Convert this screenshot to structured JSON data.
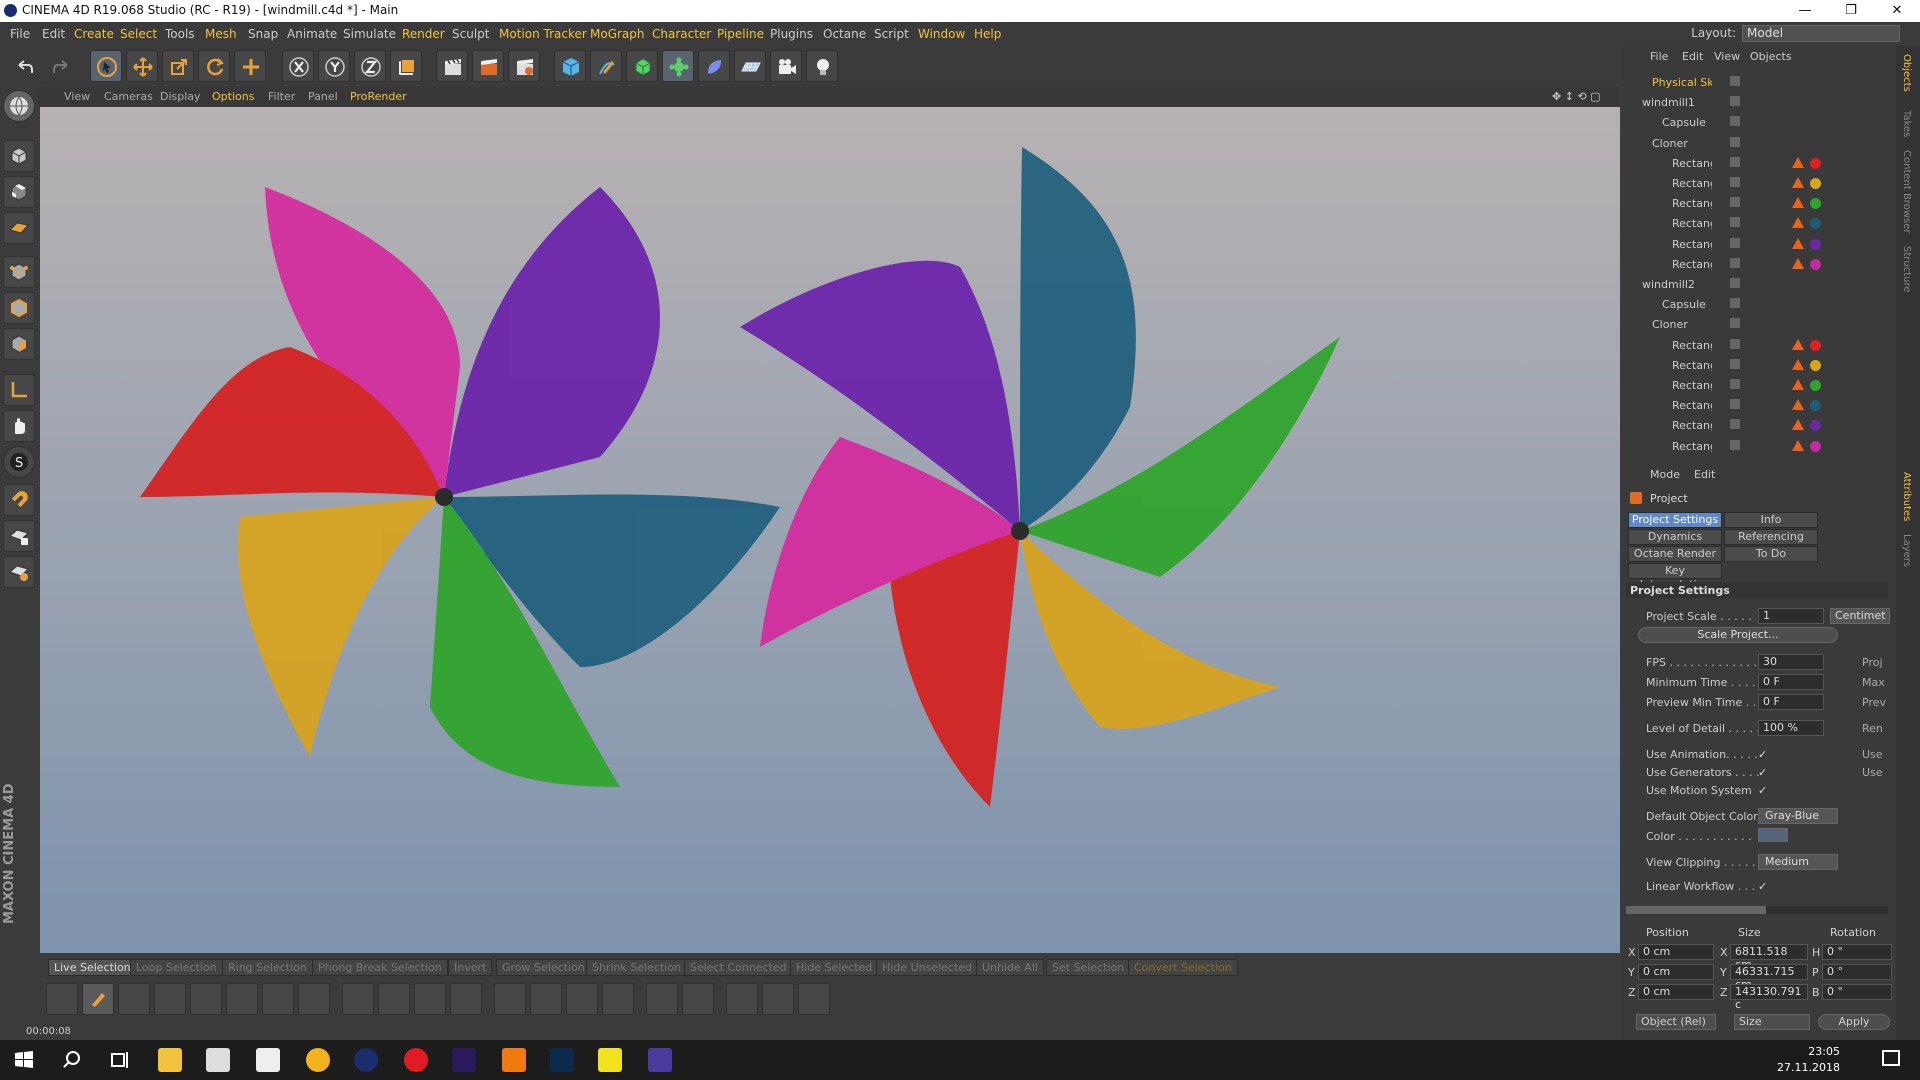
{
  "window": {
    "title": "CINEMA 4D R19.068 Studio (RC - R19) - [windmill.c4d *] - Main",
    "minimize": "—",
    "maximize": "❐",
    "close": "✕"
  },
  "menu": [
    "File",
    "Edit",
    "Create",
    "Select",
    "Tools",
    "Mesh",
    "Snap",
    "Animate",
    "Simulate",
    "Render",
    "Sculpt",
    "Motion Tracker",
    "MoGraph",
    "Character",
    "Pipeline",
    "Plugins",
    "Octane",
    "Script",
    "Window",
    "Help"
  ],
  "layout": {
    "label": "Layout:",
    "value": "Model"
  },
  "viewport_menu": [
    "View",
    "Cameras",
    "Display",
    "Options",
    "Filter",
    "Panel",
    "ProRender"
  ],
  "selection_tools": [
    "Live Selection",
    "Loop Selection",
    "Ring Selection",
    "Phong Break Selection",
    "Invert",
    "Grow Selection",
    "Shrink Selection",
    "Select Connected",
    "Hide Selected",
    "Hide Unselected",
    "Unhide All",
    "Set Selection",
    "Convert Selection"
  ],
  "timeline": {
    "time": "00:00:08"
  },
  "maxon": "MAXON CINEMA 4D",
  "objects_menu": [
    "File",
    "Edit",
    "View",
    "Objects"
  ],
  "objects": [
    {
      "name": "Physical Sky",
      "indent": 1,
      "active": true
    },
    {
      "name": "windmill1",
      "indent": 0
    },
    {
      "name": "Capsule",
      "indent": 2
    },
    {
      "name": "Cloner",
      "indent": 1
    },
    {
      "name": "Rectangle",
      "indent": 3,
      "color": "#e0201f"
    },
    {
      "name": "Rectangle",
      "indent": 3,
      "color": "#d9a61a"
    },
    {
      "name": "Rectangle",
      "indent": 3,
      "color": "#2ea52a"
    },
    {
      "name": "Rectangle",
      "indent": 3,
      "color": "#1f5c7a"
    },
    {
      "name": "Rectangle",
      "indent": 3,
      "color": "#6a2aa8"
    },
    {
      "name": "Rectangle",
      "indent": 3,
      "color": "#c22a9e"
    },
    {
      "name": "windmill2",
      "indent": 0
    },
    {
      "name": "Capsule",
      "indent": 2
    },
    {
      "name": "Cloner",
      "indent": 1
    },
    {
      "name": "Rectangle",
      "indent": 3,
      "color": "#e0201f"
    },
    {
      "name": "Rectangle",
      "indent": 3,
      "color": "#d9a61a"
    },
    {
      "name": "Rectangle",
      "indent": 3,
      "color": "#2ea52a"
    },
    {
      "name": "Rectangle",
      "indent": 3,
      "color": "#1f5c7a"
    },
    {
      "name": "Rectangle",
      "indent": 3,
      "color": "#6a2aa8"
    },
    {
      "name": "Rectangle",
      "indent": 3,
      "color": "#c22a9e"
    }
  ],
  "attributes": {
    "menu": [
      "Mode",
      "Edit"
    ],
    "object": "Project",
    "tabs": [
      "Project Settings",
      "Info",
      "Dynamics",
      "Referencing",
      "Octane Render",
      "To Do",
      "Key Interpolation"
    ],
    "section": "Project Settings",
    "project_scale": {
      "label": "Project Scale . . . . .",
      "value": "1",
      "unit": "Centimet"
    },
    "scale_button": "Scale Project...",
    "fps": {
      "label": "FPS . . . . . . . . . . . . .",
      "value": "30",
      "right": "Proj"
    },
    "min_time": {
      "label": "Minimum Time . . . .",
      "value": "0 F",
      "right": "Max"
    },
    "preview_min": {
      "label": "Preview Min Time . .",
      "value": "0 F",
      "right": "Prev"
    },
    "lod": {
      "label": "Level of Detail . . . . .",
      "value": "100 %",
      "right": "Ren"
    },
    "use_animation": {
      "label": "Use Animation. . . . .",
      "right": "Use"
    },
    "use_generators": {
      "label": "Use Generators . . . .",
      "right": "Use"
    },
    "use_motion": {
      "label": "Use Motion System"
    },
    "default_color": {
      "label": "Default Object Color",
      "value": "Gray-Blue"
    },
    "color": {
      "label": "Color . . . . . . . . . . ."
    },
    "view_clipping": {
      "label": "View Clipping . . . . .",
      "value": "Medium"
    },
    "linear_workflow": {
      "label": "Linear Workflow . . ."
    },
    "check": "✓"
  },
  "coords": {
    "headers": [
      "Position",
      "Size",
      "Rotation"
    ],
    "rows": [
      {
        "axis": "X",
        "pos": "0 cm",
        "size": "6811.518 cm",
        "rlabel": "H",
        "rot": "0 °"
      },
      {
        "axis": "Y",
        "pos": "0 cm",
        "size": "46331.715 cm",
        "rlabel": "P",
        "rot": "0 °"
      },
      {
        "axis": "Z",
        "pos": "0 cm",
        "size": "143130.791 c",
        "rlabel": "B",
        "rot": "0 °"
      }
    ],
    "mode": "Object (Rel)",
    "size_mode": "Size",
    "apply": "Apply"
  },
  "side_tabs": [
    "Objects",
    "Takes",
    "Content Browser",
    "Structure",
    "Attributes",
    "Layers"
  ],
  "taskbar": {
    "time": "23:05",
    "date": "27.11.2018"
  }
}
